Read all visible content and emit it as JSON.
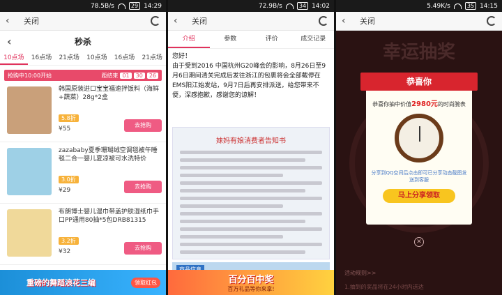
{
  "p1": {
    "status": {
      "speed": "78.5B/s",
      "battery": "29",
      "time": "14:29"
    },
    "titlebar": {
      "close": "关闭"
    },
    "header": {
      "title": "秒杀"
    },
    "tabs": [
      "10点场",
      "16点场",
      "21点场",
      "10点场",
      "16点场",
      "21点场"
    ],
    "bar": {
      "left": "抢购中10:00开始",
      "end": "距结束",
      "cd1": "01",
      "cd2": "30",
      "cd3": "26"
    },
    "products": [
      {
        "title": "韩国原装进口宝宝福速拌饭料（海鲜+蔬菜）28g*2盒",
        "discount": "5.8折",
        "price": "¥55",
        "buy": "去抢购",
        "color": "#c9a07a"
      },
      {
        "title": "zazababy夏季珊瑚绒空调毯被午睡毯二合一婴儿夏凉被可水洗特价",
        "discount": "3.0折",
        "price": "¥29",
        "buy": "去抢购",
        "color": "#9ed0e6"
      },
      {
        "title": "布朗博士婴儿湿巾带盖护肤湿纸巾手口PP通用80抽*5包DRB81315",
        "discount": "3.2折",
        "price": "¥32",
        "buy": "去抢购",
        "color": "#f0d99a"
      }
    ],
    "ad": {
      "text": "重磅的舞蹈浪花三编",
      "btn": "领取红包"
    }
  },
  "p2": {
    "status": {
      "speed": "72.9B/s",
      "battery": "34",
      "time": "14:02"
    },
    "titlebar": {
      "close": "关闭"
    },
    "tabs": [
      "介绍",
      "参数",
      "评价",
      "成交记录"
    ],
    "notice": "您好！\n由于受到2016 中国杭州G20峰会的影响，8月26日至9月6日期间清关完成后发往浙江的包裹将会全部截停在EMS阳江始发站，9月7日后再安排派送，给您带来不便，深感抱歉，感谢您的谅解！",
    "card_title": "妹妈有娘消费者告知书",
    "pinfo_label": "商品信息",
    "ad": {
      "big": "百分百中奖",
      "small": "百万礼品等你来拿!"
    }
  },
  "p3": {
    "status": {
      "speed": "5.49K/s",
      "battery": "35",
      "time": "14:15"
    },
    "titlebar": {
      "close": "关闭"
    },
    "logo": "幸运抽奖",
    "modal": {
      "title": "恭喜你",
      "msg_pre": "恭喜你抽中价值",
      "price": "2980元",
      "msg_post": "的时尚腕表",
      "note": "分享到QQ空间后点击即可已分享动态截图发送到客服",
      "share": "马上分享领取"
    },
    "rules": "活动规则>>",
    "rules2": "1.抽到的奖品将在24小时内送达"
  }
}
